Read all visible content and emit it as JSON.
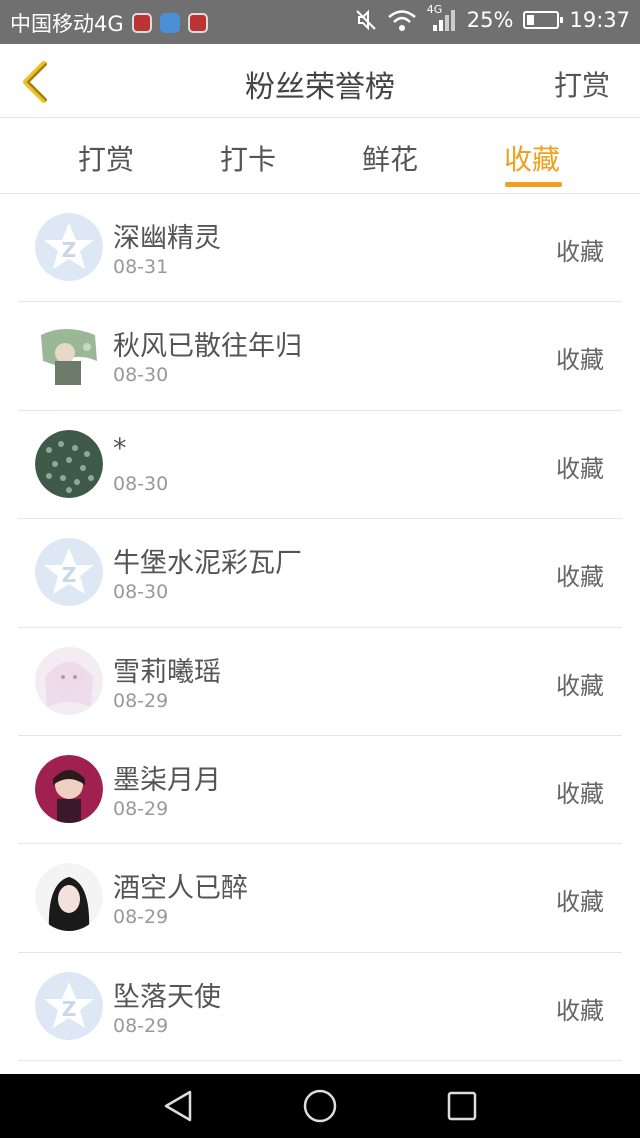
{
  "status_bar": {
    "carrier": "中国移动4G",
    "network": "4G",
    "battery_text": "25%",
    "battery_level": 0.25,
    "time": "19:37"
  },
  "header": {
    "title": "粉丝荣誉榜",
    "action": "打赏"
  },
  "tabs": [
    {
      "label": "打赏",
      "active": false
    },
    {
      "label": "打卡",
      "active": false
    },
    {
      "label": "鲜花",
      "active": false
    },
    {
      "label": "收藏",
      "active": true
    }
  ],
  "fans": [
    {
      "name": "深幽精灵",
      "date": "08-31",
      "action": "收藏",
      "avatar": "default-avatar"
    },
    {
      "name": "秋风已散往年归",
      "date": "08-30",
      "action": "收藏",
      "avatar": "illustration-avatar"
    },
    {
      "name": "*",
      "date": "08-30",
      "action": "收藏",
      "avatar": "pattern-avatar"
    },
    {
      "name": "牛堡水泥彩瓦厂",
      "date": "08-30",
      "action": "收藏",
      "avatar": "default-avatar"
    },
    {
      "name": "雪莉曦瑶",
      "date": "08-29",
      "action": "收藏",
      "avatar": "anime-avatar"
    },
    {
      "name": "墨柒月月",
      "date": "08-29",
      "action": "收藏",
      "avatar": "photo-avatar"
    },
    {
      "name": "酒空人已醉",
      "date": "08-29",
      "action": "收藏",
      "avatar": "portrait-avatar"
    },
    {
      "name": "坠落天使",
      "date": "08-29",
      "action": "收藏",
      "avatar": "default-avatar"
    }
  ],
  "colors": {
    "accent": "#f0a020",
    "status_bar": "#707070",
    "nav_bar": "#000000"
  }
}
